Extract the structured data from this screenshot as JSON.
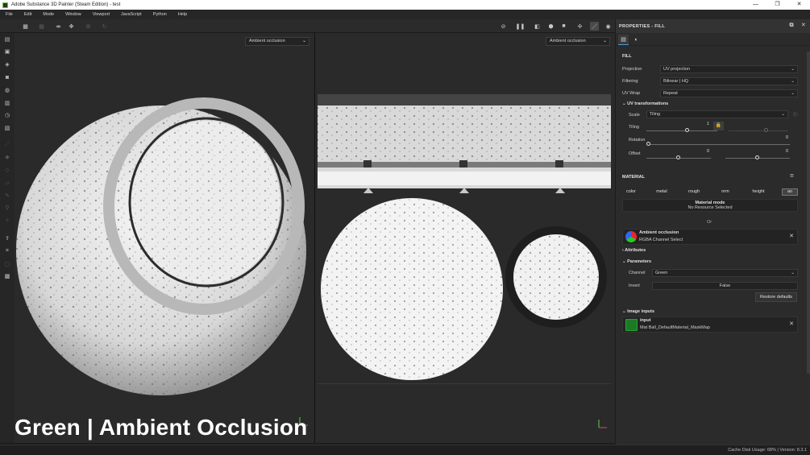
{
  "window": {
    "title": "Adobe Substance 3D Painter (Steam Edition) - test",
    "controls": [
      "—",
      "❐",
      "✕"
    ]
  },
  "menu": [
    "File",
    "Edit",
    "Mode",
    "Window",
    "Viewport",
    "JavaScript",
    "Python",
    "Help"
  ],
  "viewport3d": {
    "channel_dropdown": "Ambient occlusion",
    "overlay_text": "Green | Ambient Occlusion"
  },
  "viewport2d": {
    "channel_dropdown": "Ambient occlusion"
  },
  "properties": {
    "header": "PROPERTIES - FILL",
    "fill_section": "FILL",
    "projection": {
      "label": "Projection",
      "value": "UV projection"
    },
    "filtering": {
      "label": "Filtering",
      "value": "Bilinear | HQ"
    },
    "uvwrap": {
      "label": "UV Wrap",
      "value": "Repeat"
    },
    "uv_transformations": {
      "header": "UV transformations",
      "scale": {
        "label": "Scale",
        "value": "Tiling"
      },
      "tiling": {
        "label": "Tiling",
        "value": "1"
      },
      "rotation": {
        "label": "Rotation",
        "value": "0"
      },
      "offset": {
        "label": "Offset",
        "value_x": "0",
        "value_y": "0"
      }
    },
    "material": {
      "header": "MATERIAL",
      "chips": [
        "color",
        "metal",
        "rough",
        "nrm",
        "height",
        "ao"
      ],
      "active_chip": "ao",
      "mode_title": "Material mode",
      "mode_value": "No Resource Selected",
      "or_label": "Or"
    },
    "resource": {
      "title": "Ambient occlusion",
      "subtitle": "RGBA Channel Select"
    },
    "attributes_header": "Attributes",
    "parameters": {
      "header": "Parameters",
      "channel": {
        "label": "Channel",
        "value": "Green"
      },
      "invert": {
        "label": "Invert",
        "value": "False"
      },
      "restore_button": "Restore defaults"
    },
    "image_inputs": {
      "header": "Image inputs",
      "input_title": "input",
      "input_value": "Mat Ball_DefaultMaterial_MaskMap"
    }
  },
  "statusbar": {
    "text": "Cache Disk Usage:  68% | Version: 8.3.1"
  }
}
